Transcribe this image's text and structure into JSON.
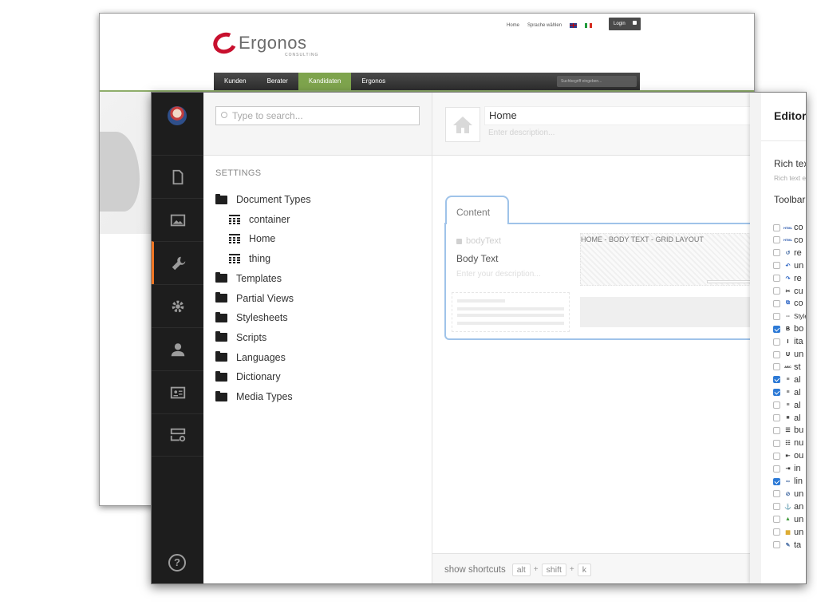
{
  "site": {
    "logo": {
      "word": "Ergonos",
      "sub": "CONSULTING"
    },
    "toplinks": {
      "home": "Home",
      "language": "Sprache wählen"
    },
    "login": "Login",
    "nav": [
      "Kunden",
      "Berater",
      "Kandidaten",
      "Ergonos"
    ],
    "nav_active": "Kandidaten",
    "search_placeholder": "Suchbegriff eingeben..."
  },
  "tree": {
    "search_placeholder": "Type to search...",
    "section": "SETTINGS",
    "items": [
      {
        "label": "Document Types",
        "icon": "folder-icon",
        "indent": 0
      },
      {
        "label": "container",
        "icon": "grid-icon",
        "indent": 1
      },
      {
        "label": "Home",
        "icon": "grid-icon",
        "indent": 1
      },
      {
        "label": "thing",
        "icon": "grid-icon",
        "indent": 1
      },
      {
        "label": "Templates",
        "icon": "folder-icon",
        "indent": 0
      },
      {
        "label": "Partial Views",
        "icon": "folder-icon",
        "indent": 0
      },
      {
        "label": "Stylesheets",
        "icon": "folder-icon",
        "indent": 0
      },
      {
        "label": "Scripts",
        "icon": "folder-icon",
        "indent": 0
      },
      {
        "label": "Languages",
        "icon": "folder-icon",
        "indent": 0
      },
      {
        "label": "Dictionary",
        "icon": "folder-icon",
        "indent": 0
      },
      {
        "label": "Media Types",
        "icon": "folder-icon",
        "indent": 0
      }
    ]
  },
  "editor": {
    "name": "Home",
    "description_placeholder": "Enter description...",
    "tab": "Content",
    "property": {
      "alias": "bodyText",
      "name": "Body Text",
      "description_placeholder": "Enter your description...",
      "layout_label": "HOME - BODY TEXT - GRID LAYOUT"
    },
    "shortcuts": {
      "label": "show shortcuts",
      "keys": [
        "alt",
        "shift",
        "k"
      ]
    }
  },
  "panel": {
    "title": "Editor",
    "label": "Rich tex",
    "sub": "Rich text e",
    "toolbar": "Toolbar",
    "rows": [
      {
        "ico": "HTML",
        "text": "co",
        "checked": false,
        "color": "#1f4fa8"
      },
      {
        "ico": "HTML",
        "text": "co",
        "checked": false,
        "color": "#1f4fa8"
      },
      {
        "ico": "↺",
        "text": "re",
        "checked": false,
        "color": "#4a6fa5"
      },
      {
        "ico": "↶",
        "text": "un",
        "checked": false,
        "color": "#2f66c4"
      },
      {
        "ico": "↷",
        "text": "re",
        "checked": false,
        "color": "#2f66c4"
      },
      {
        "ico": "✂",
        "text": "cu",
        "checked": false,
        "color": "#333333"
      },
      {
        "ico": "⧉",
        "text": "co",
        "checked": false,
        "color": "#2f66c4"
      },
      {
        "ico": "--",
        "text": "Style",
        "checked": false,
        "color": "#555555"
      },
      {
        "ico": "B",
        "text": "bo",
        "checked": true,
        "color": "#111111"
      },
      {
        "ico": "I",
        "text": "ita",
        "checked": false,
        "color": "#111111"
      },
      {
        "ico": "U",
        "text": "un",
        "checked": false,
        "color": "#111111"
      },
      {
        "ico": "ABC",
        "text": "st",
        "checked": false,
        "color": "#111111"
      },
      {
        "ico": "≡",
        "text": "al",
        "checked": true,
        "color": "#333333"
      },
      {
        "ico": "≡",
        "text": "al",
        "checked": true,
        "color": "#333333"
      },
      {
        "ico": "≡",
        "text": "al",
        "checked": false,
        "color": "#333333"
      },
      {
        "ico": "■",
        "text": "al",
        "checked": false,
        "color": "#555555"
      },
      {
        "ico": "☰",
        "text": "bu",
        "checked": false,
        "color": "#333333"
      },
      {
        "ico": "☷",
        "text": "nu",
        "checked": false,
        "color": "#333333"
      },
      {
        "ico": "⇤",
        "text": "ou",
        "checked": false,
        "color": "#333333"
      },
      {
        "ico": "⇥",
        "text": "in",
        "checked": false,
        "color": "#333333"
      },
      {
        "ico": "∞",
        "text": "lin",
        "checked": true,
        "color": "#4a6fa5"
      },
      {
        "ico": "⊘",
        "text": "un",
        "checked": false,
        "color": "#4a6fa5"
      },
      {
        "ico": "⚓",
        "text": "an",
        "checked": false,
        "color": "#2f66c4"
      },
      {
        "ico": "▲",
        "text": "un",
        "checked": false,
        "color": "#3e9a3a"
      },
      {
        "ico": "▦",
        "text": "un",
        "checked": false,
        "color": "#d9a21b"
      },
      {
        "ico": "✎",
        "text": "ta",
        "checked": false,
        "color": "#4a6fa5"
      }
    ]
  },
  "colors": {
    "accent": "#f17623",
    "rail": "#1d1d1d",
    "tab_border": "#9fc3e9",
    "nav_active": "#7ea44d",
    "checkbox_on": "#2d7ad6"
  }
}
